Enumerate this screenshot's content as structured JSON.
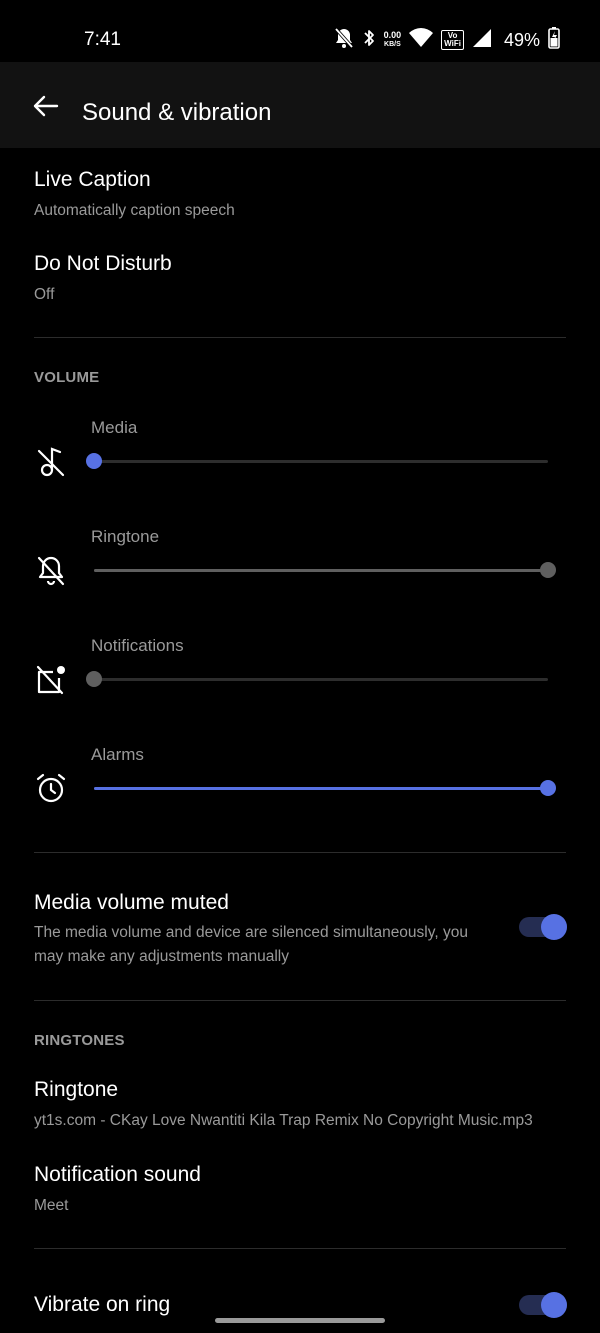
{
  "status_bar": {
    "time": "7:41",
    "net_speed_value": "0.00",
    "net_speed_unit": "KB/S",
    "vowifi_line1": "Vo",
    "vowifi_line2": "WiFi",
    "battery_percent": "49%",
    "icons": [
      "notifications-off-icon",
      "bluetooth-icon",
      "wifi-icon",
      "signal-icon",
      "battery-charging-icon"
    ]
  },
  "app_bar": {
    "title": "Sound & vibration",
    "back_icon": "back-arrow-icon"
  },
  "live_caption": {
    "title": "Live Caption",
    "subtitle": "Automatically caption speech"
  },
  "do_not_disturb": {
    "title": "Do Not Disturb",
    "subtitle": "Off"
  },
  "volume": {
    "header": "VOLUME",
    "sliders": [
      {
        "label": "Media",
        "icon": "music-off-icon",
        "level": 0.0
      },
      {
        "label": "Ringtone",
        "icon": "bell-off-icon",
        "level": 1.0
      },
      {
        "label": "Notifications",
        "icon": "notification-off-icon",
        "level": 0.0
      },
      {
        "label": "Alarms",
        "icon": "alarm-clock-icon",
        "level": 1.0
      }
    ]
  },
  "media_volume_muted": {
    "title": "Media volume muted",
    "subtitle": "The media volume and device are silenced simultaneously, you may make any adjustments manually",
    "enabled": true
  },
  "ringtones": {
    "header": "RINGTONES",
    "ringtone": {
      "title": "Ringtone",
      "subtitle": "yt1s.com - CKay  Love Nwantiti Kila Trap Remix No Copyright Music.mp3"
    },
    "notification_sound": {
      "title": "Notification sound",
      "subtitle": "Meet"
    }
  },
  "vibrate_on_ring": {
    "title": "Vibrate on ring",
    "enabled": true
  },
  "colors": {
    "accent": "#5771e3",
    "accent_track": "#252d52",
    "muted_gray": "#5f5f5f",
    "background": "#000000",
    "app_bar": "#121212",
    "secondary_text": "#9a9a9a"
  }
}
